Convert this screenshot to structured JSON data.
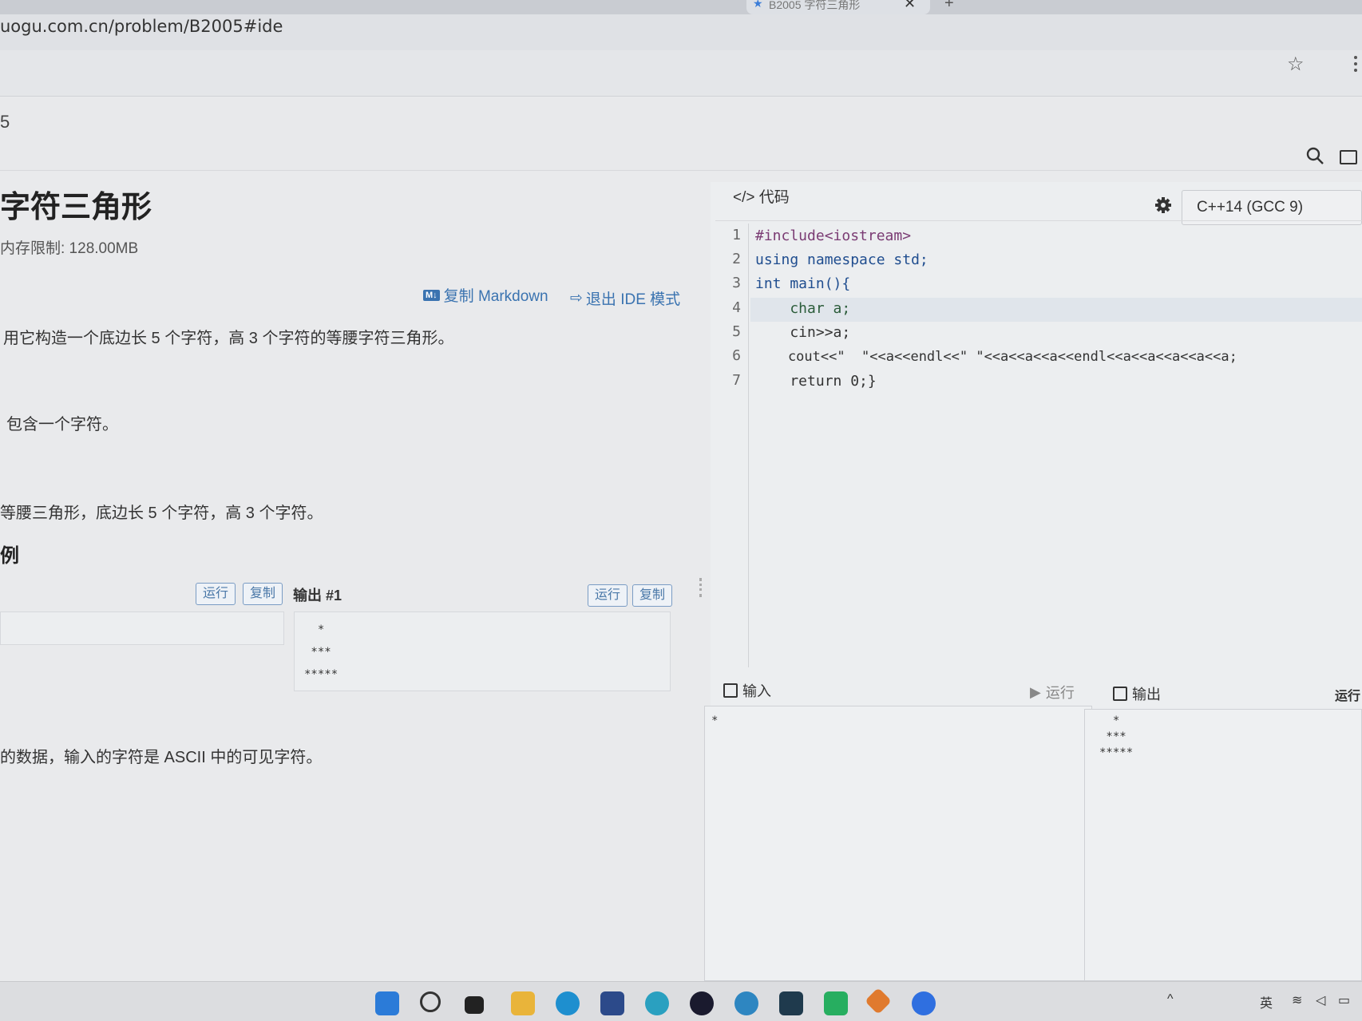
{
  "browser": {
    "tab_title": "B2005 字符三角形",
    "tab_close": "✕",
    "tab_new": "+",
    "url": "uogu.com.cn/problem/B2005#ide"
  },
  "header": {
    "breadcrumb": "5"
  },
  "problem": {
    "title": "字符三角形",
    "memory_limit": "内存限制: 128.00MB",
    "copy_markdown": "复制 Markdown",
    "md_badge": "M↓",
    "exit_ide": "退出 IDE 模式",
    "description": "用它构造一个底边长 5 个字符，高 3 个字符的等腰字符三角形。",
    "input_format": "包含一个字符。",
    "output_format": "等腰三角形，底边长 5 个字符，高 3 个字符。",
    "samples_heading": "例",
    "run_label": "运行",
    "copy_label": "复制",
    "output_label": "输出 #1",
    "sample_output": "  *\n ***\n*****",
    "note": "的数据，输入的字符是 ASCII 中的可见字符。"
  },
  "ide": {
    "tab_label": "代码",
    "tab_symbol": "</>",
    "language": "C++14 (GCC 9)",
    "code_lines": [
      {
        "n": "1",
        "text": "#include<iostream>"
      },
      {
        "n": "2",
        "text": "using namespace std;"
      },
      {
        "n": "3",
        "text": "int main(){"
      },
      {
        "n": "4",
        "text": "    char a;"
      },
      {
        "n": "5",
        "text": "    cin>>a;"
      },
      {
        "n": "6",
        "text": "    cout<<\"  \"<<a<<endl<<\" \"<<a<<a<<a<<endl<<a<<a<<a<<a<<a;"
      },
      {
        "n": "7",
        "text": "    return 0;}"
      }
    ],
    "input_label": "输入",
    "run_label": "运行",
    "output_label": "输出",
    "run_right": "运行",
    "input_value": "*",
    "output_value": "  *\n ***\n*****"
  },
  "taskbar": {
    "lang_indicator": "英"
  },
  "colors": {
    "accent": "#3a73b0",
    "keyword": "#1f4d8f",
    "preprocessor": "#7a3b73"
  }
}
